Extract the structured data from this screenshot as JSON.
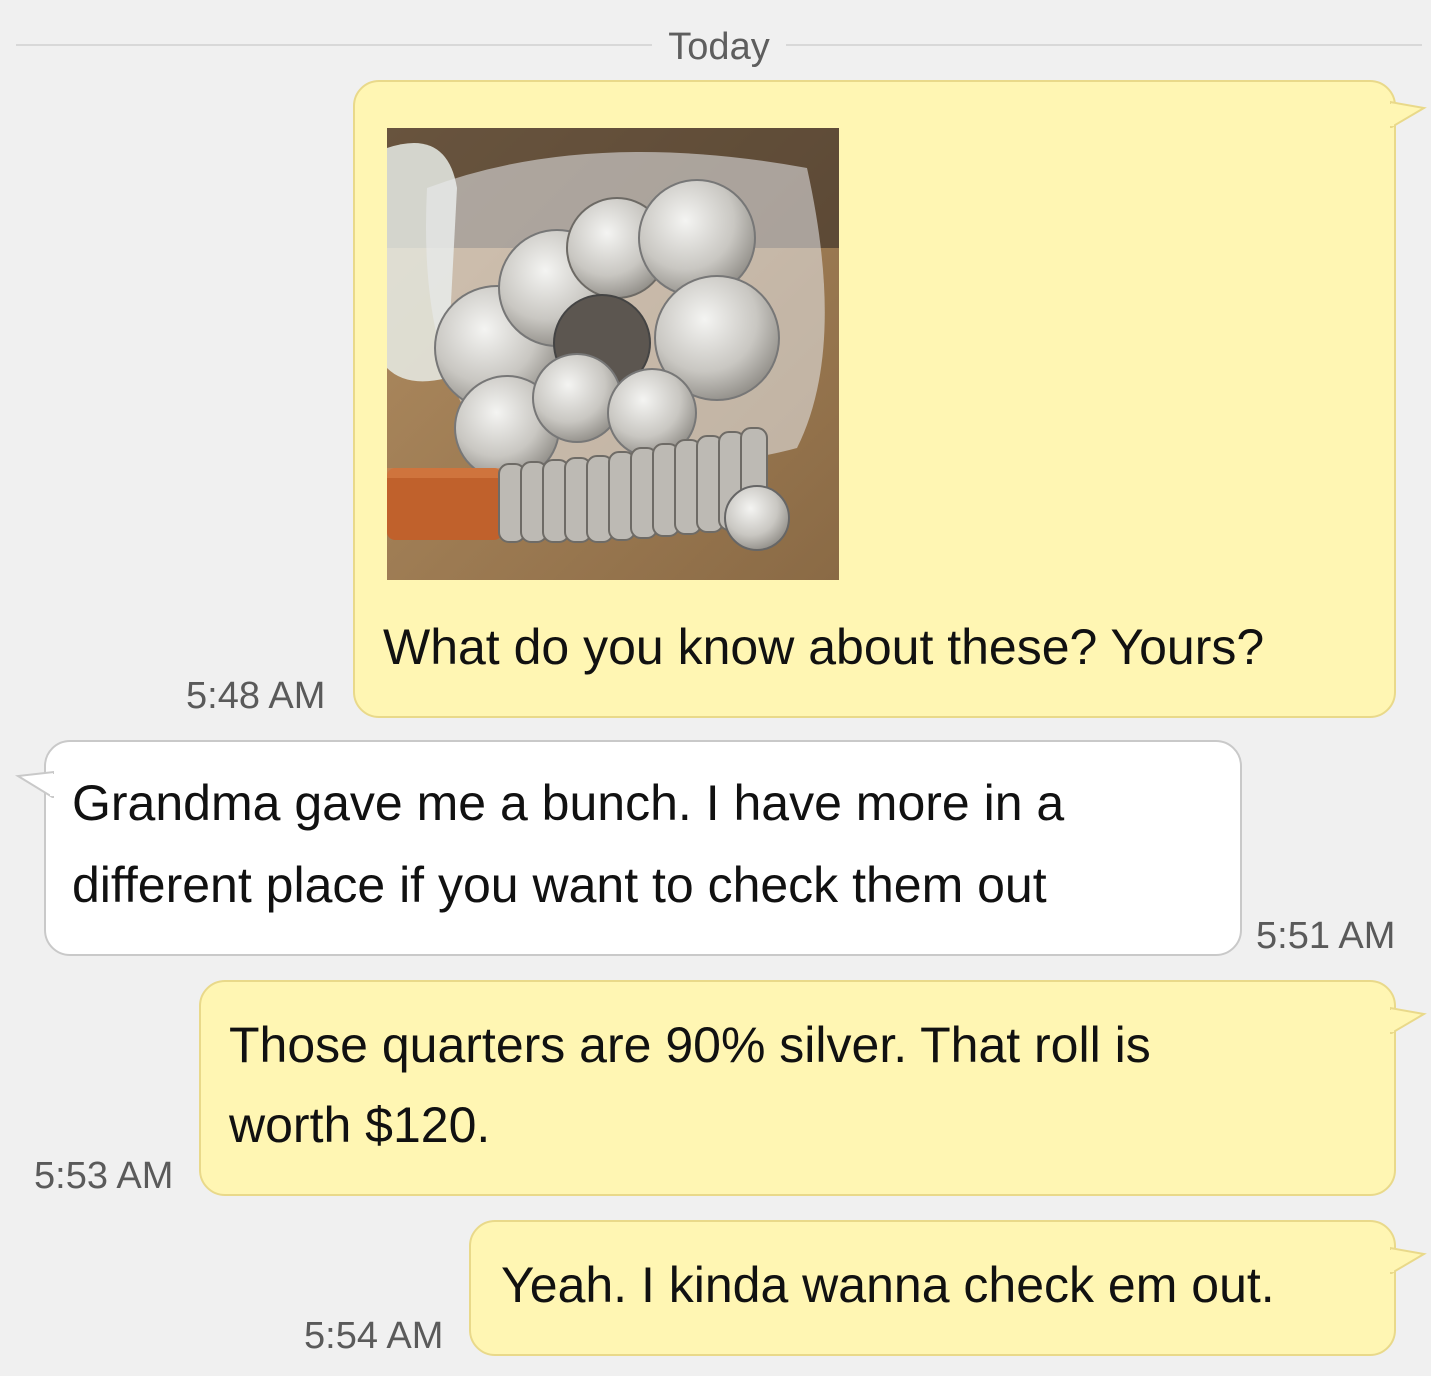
{
  "thread": {
    "date_divider": "Today"
  },
  "messages": [
    {
      "direction": "outgoing",
      "has_image": true,
      "image_description": "photo-of-coins",
      "text": "What do you know about these? Yours?",
      "time": "5:48 AM"
    },
    {
      "direction": "incoming",
      "lines": [
        "Grandma gave me a bunch. I have more in a",
        "different place if you want to check them out"
      ],
      "time": "5:51 AM"
    },
    {
      "direction": "outgoing",
      "lines": [
        "Those quarters are 90% silver. That roll is",
        "worth $120."
      ],
      "time": "5:53 AM"
    },
    {
      "direction": "outgoing",
      "text": "Yeah. I kinda wanna check em out.",
      "time": "5:54 AM"
    }
  ],
  "colors": {
    "background": "#f0f0f0",
    "outgoing_bubble": "#fff6b3",
    "incoming_bubble": "#ffffff",
    "timestamp": "#5a5a5a"
  }
}
